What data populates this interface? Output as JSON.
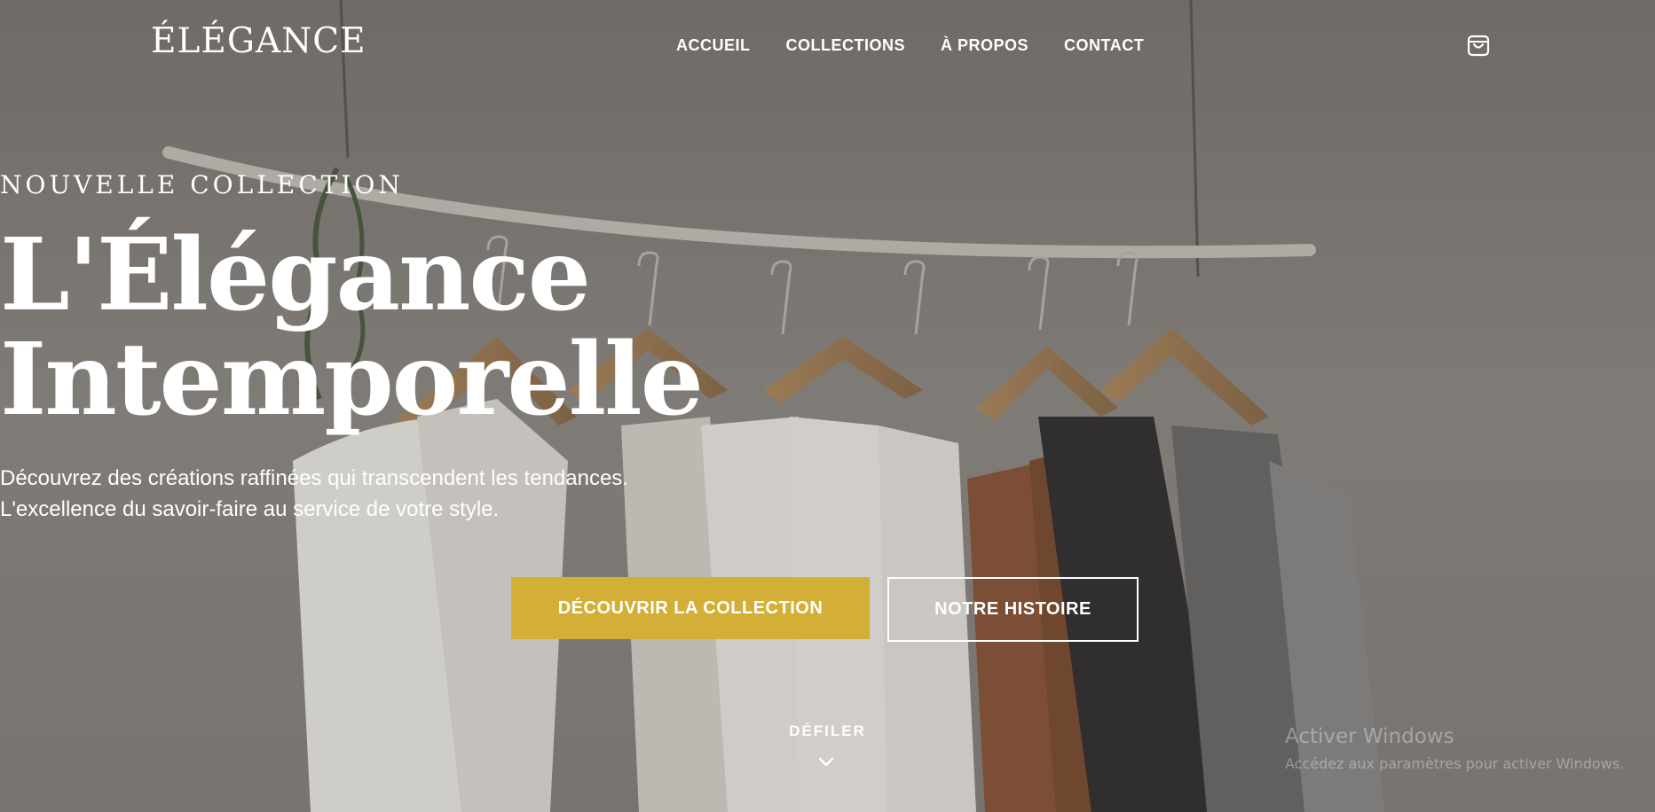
{
  "brand": {
    "logo": "ÉLÉGANCE"
  },
  "nav": {
    "items": [
      {
        "label": "ACCUEIL"
      },
      {
        "label": "COLLECTIONS"
      },
      {
        "label": "À PROPOS"
      },
      {
        "label": "CONTACT"
      }
    ],
    "cart_icon": "shopping-bag-icon"
  },
  "hero": {
    "eyebrow": "NOUVELLE COLLECTION",
    "title_line1": "L'Élégance",
    "title_line2": "Intemporelle",
    "subtitle_line1": "Découvrez des créations raffinées qui transcendent les tendances.",
    "subtitle_line2": "L'excellence du savoir-faire au service de votre style.",
    "primary_cta": "DÉCOUVRIR LA COLLECTION",
    "secondary_cta": "NOTRE HISTOIRE",
    "scroll_label": "DÉFILER",
    "scroll_icon": "chevron-down-icon"
  },
  "watermark": {
    "title": "Activer Windows",
    "subtitle": "Accédez aux paramètres pour activer Windows."
  },
  "colors": {
    "accent": "#d4af37",
    "text": "#ffffff"
  }
}
